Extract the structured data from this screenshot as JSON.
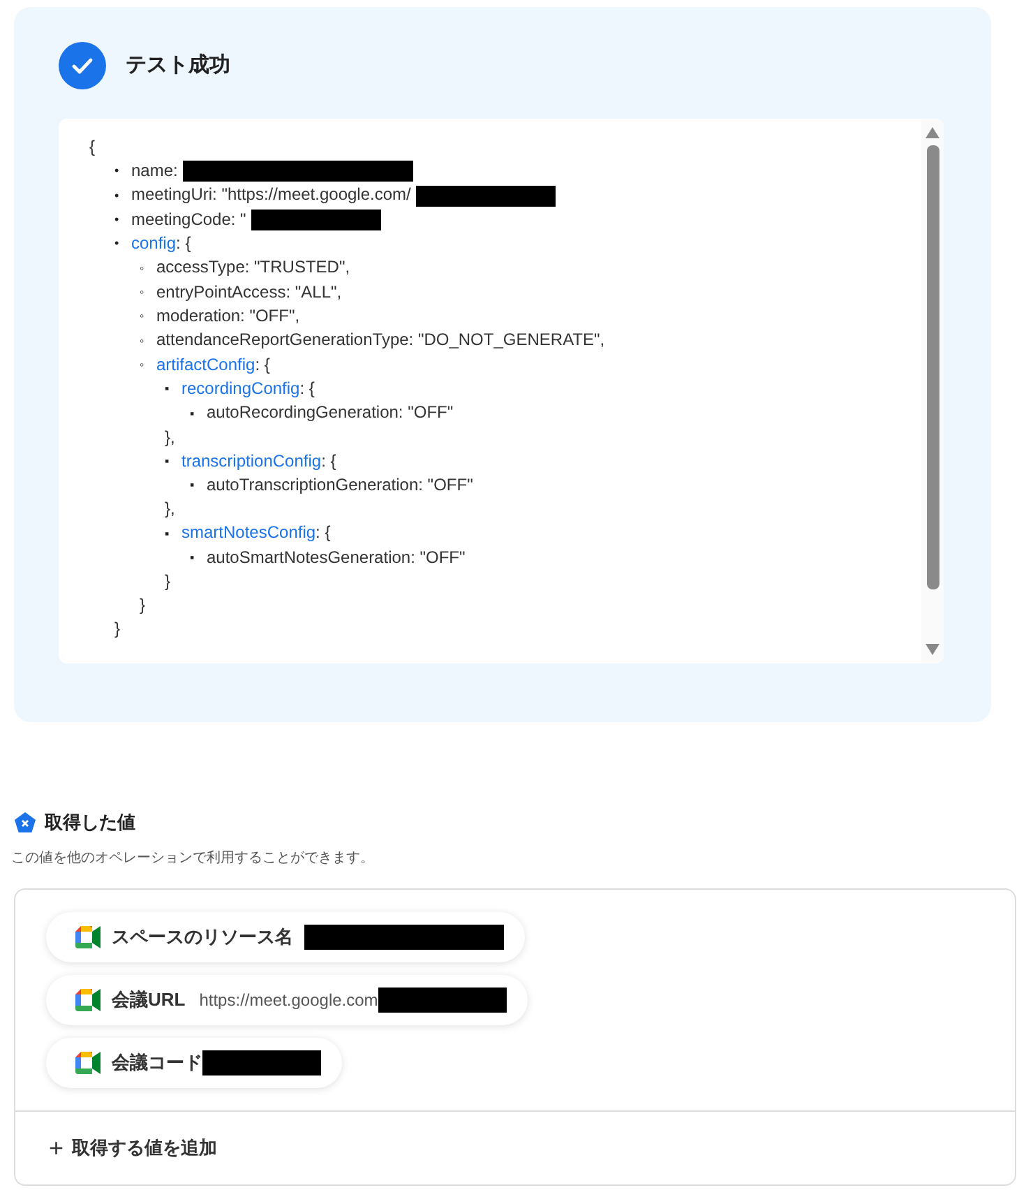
{
  "test_result": {
    "title": "テスト成功",
    "success": true,
    "json_view": {
      "open": "{",
      "items": [
        {
          "marker": "•",
          "text": "name:",
          "redacted": true
        },
        {
          "marker": "•",
          "text": "meetingUri: \"https://meet.google.com/",
          "redacted": true
        },
        {
          "marker": "•",
          "text": "meetingCode: \"",
          "redacted": true
        },
        {
          "marker": "•",
          "key": "config",
          "open": ": {",
          "close": "}",
          "children": [
            {
              "marker": "◦",
              "text": "accessType: \"TRUSTED\","
            },
            {
              "marker": "◦",
              "text": "entryPointAccess: \"ALL\","
            },
            {
              "marker": "◦",
              "text": "moderation: \"OFF\","
            },
            {
              "marker": "◦",
              "text": "attendanceReportGenerationType: \"DO_NOT_GENERATE\","
            },
            {
              "marker": "◦",
              "key": "artifactConfig",
              "open": ": {",
              "close": "}",
              "children": [
                {
                  "marker": "▪",
                  "key": "recordingConfig",
                  "open": ": {",
                  "close": "},",
                  "children": [
                    {
                      "marker": "▪",
                      "text": "autoRecordingGeneration: \"OFF\""
                    }
                  ]
                },
                {
                  "marker": "▪",
                  "key": "transcriptionConfig",
                  "open": ": {",
                  "close": "},",
                  "children": [
                    {
                      "marker": "▪",
                      "text": "autoTranscriptionGeneration: \"OFF\""
                    }
                  ]
                },
                {
                  "marker": "▪",
                  "key": "smartNotesConfig",
                  "open": ": {",
                  "close": "}",
                  "children": [
                    {
                      "marker": "▪",
                      "text": "autoSmartNotesGeneration: \"OFF\""
                    }
                  ]
                }
              ]
            }
          ]
        }
      ]
    }
  },
  "outputs": {
    "title": "取得した値",
    "description": "この値を他のオペレーションで利用することができます。",
    "items": [
      {
        "label": "スペースのリソース名",
        "redacted": true
      },
      {
        "label": "会議URL",
        "value": "https://meet.google.com",
        "redacted": true
      },
      {
        "label": "会議コード",
        "redacted": true
      }
    ],
    "add_button": {
      "icon": "+",
      "label": "取得する値を追加"
    }
  }
}
